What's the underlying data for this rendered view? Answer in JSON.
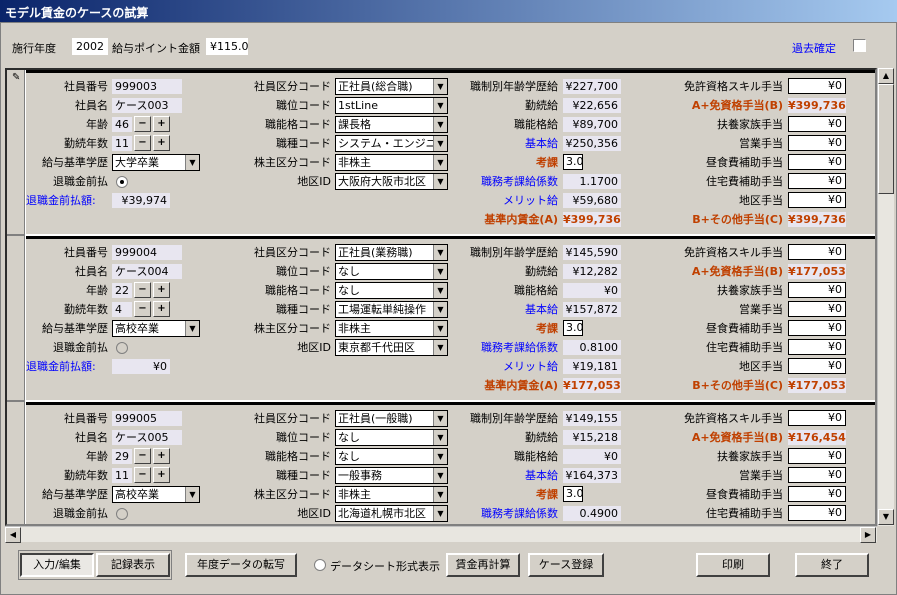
{
  "window": {
    "title": "モデル賃金のケースの試算"
  },
  "header": {
    "fiscal_year_label": "施行年度",
    "fiscal_year_value": "2002",
    "point_amount_label": "給与ポイント金額",
    "point_amount_value": "¥115.0",
    "past_confirm_label": "過去確定"
  },
  "labels": {
    "emp_no": "社員番号",
    "emp_name": "社員名",
    "age": "年齢",
    "years": "勤続年数",
    "education": "給与基準学歴",
    "retire_advance": "退職金前払",
    "retire_advance_amount": "退職金前払額:",
    "emp_class": "社員区分コード",
    "position": "職位コード",
    "grade": "職能格コード",
    "job_type": "職種コード",
    "shareholder": "株主区分コード",
    "area_id": "地区ID",
    "age_edu_pay": "職制別年齢学歴給",
    "tenure_pay": "勤続給",
    "grade_pay": "職能格給",
    "base_pay": "基本給",
    "evaluation": "考課",
    "eval_coef": "職務考課給係数",
    "merit_pay": "メリット給",
    "base_wage_a": "基準内賃金(A)",
    "license_allowance": "免許資格スキル手当",
    "a_plus_license": "A+免資格手当(B)",
    "family_allowance": "扶養家族手当",
    "sales_allowance": "営業手当",
    "lunch_allowance": "昼食費補助手当",
    "housing_allowance": "住宅費補助手当",
    "area_allowance": "地区手当",
    "b_plus_other": "B+その他手当(C)"
  },
  "records": [
    {
      "emp_no": "999003",
      "emp_name": "ケース003",
      "age": "46",
      "years": "11",
      "education": "大学卒業",
      "retire_advance_amount": "¥39,974",
      "emp_class": "正社員(総合職)",
      "position": "1stLine",
      "grade": "課長格",
      "job_type": "システム・エンジニア",
      "shareholder": "非株主",
      "area": "大阪府大阪市北区",
      "age_edu_pay": "¥227,700",
      "tenure_pay": "¥22,656",
      "grade_pay": "¥89,700",
      "base_pay": "¥250,356",
      "evaluation": "3.0",
      "eval_coef": "1.1700",
      "merit_pay": "¥59,680",
      "base_wage_a": "¥399,736",
      "license_allowance": "¥0",
      "a_plus_license": "¥399,736",
      "family_allowance": "¥0",
      "sales_allowance": "¥0",
      "lunch_allowance": "¥0",
      "housing_allowance": "¥0",
      "area_allowance": "¥0",
      "b_plus_other": "¥399,736"
    },
    {
      "emp_no": "999004",
      "emp_name": "ケース004",
      "age": "22",
      "years": "4",
      "education": "高校卒業",
      "retire_advance_amount": "¥0",
      "emp_class": "正社員(業務職)",
      "position": "なし",
      "grade": "なし",
      "job_type": "工場運転単純操作",
      "shareholder": "非株主",
      "area": "東京都千代田区",
      "age_edu_pay": "¥145,590",
      "tenure_pay": "¥12,282",
      "grade_pay": "¥0",
      "base_pay": "¥157,872",
      "evaluation": "3.0",
      "eval_coef": "0.8100",
      "merit_pay": "¥19,181",
      "base_wage_a": "¥177,053",
      "license_allowance": "¥0",
      "a_plus_license": "¥177,053",
      "family_allowance": "¥0",
      "sales_allowance": "¥0",
      "lunch_allowance": "¥0",
      "housing_allowance": "¥0",
      "area_allowance": "¥0",
      "b_plus_other": "¥177,053"
    },
    {
      "emp_no": "999005",
      "emp_name": "ケース005",
      "age": "29",
      "years": "11",
      "education": "高校卒業",
      "retire_advance_amount": "",
      "emp_class": "正社員(一般職)",
      "position": "なし",
      "grade": "なし",
      "job_type": "一般事務",
      "shareholder": "非株主",
      "area": "北海道札幌市北区",
      "age_edu_pay": "¥149,155",
      "tenure_pay": "¥15,218",
      "grade_pay": "¥0",
      "base_pay": "¥164,373",
      "evaluation": "3.0",
      "eval_coef": "0.4900",
      "merit_pay": "",
      "base_wage_a": "",
      "license_allowance": "¥0",
      "a_plus_license": "¥176,454",
      "family_allowance": "¥0",
      "sales_allowance": "¥0",
      "lunch_allowance": "¥0",
      "housing_allowance": "¥0",
      "area_allowance": "",
      "b_plus_other": ""
    }
  ],
  "buttons": {
    "input_edit": "入力/編集",
    "record_view": "記録表示",
    "year_transfer": "年度データの転写",
    "datasheet_view": "データシート形式表示",
    "recalc": "賃金再計算",
    "case_register": "ケース登録",
    "print": "印刷",
    "close": "終了"
  },
  "colors": {
    "accent_red": "#c04000",
    "link_blue": "#0000ff",
    "title_bar": "#0a246a"
  }
}
